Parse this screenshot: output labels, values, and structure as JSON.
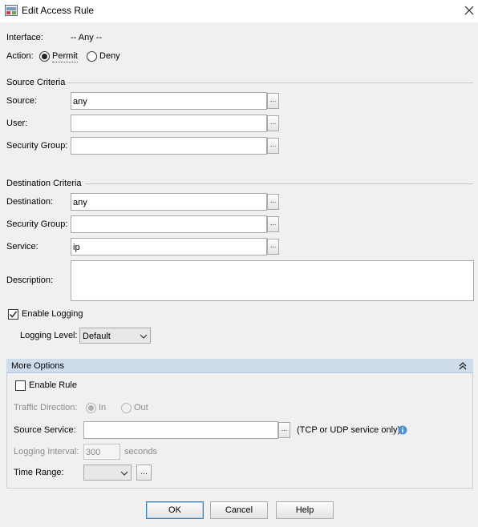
{
  "window": {
    "title": "Edit Access Rule",
    "icon": "asdm-app-icon",
    "close_icon": "close-icon"
  },
  "interface": {
    "label": "Interface:",
    "value": "-- Any --"
  },
  "action": {
    "label": "Action:",
    "options": [
      {
        "label": "Permit",
        "selected": true
      },
      {
        "label": "Deny",
        "selected": false
      }
    ]
  },
  "source_criteria": {
    "title": "Source Criteria",
    "source": {
      "label": "Source:",
      "value": "any"
    },
    "user": {
      "label": "User:",
      "value": ""
    },
    "security_group": {
      "label": "Security Group:",
      "value": ""
    },
    "browse_label": "..."
  },
  "destination_criteria": {
    "title": "Destination Criteria",
    "destination": {
      "label": "Destination:",
      "value": "any"
    },
    "security_group": {
      "label": "Security Group:",
      "value": ""
    },
    "service": {
      "label": "Service:",
      "value": "ip"
    },
    "browse_label": "..."
  },
  "description": {
    "label": "Description:",
    "value": ""
  },
  "logging": {
    "enable_label": "Enable Logging",
    "enabled": true,
    "level_label": "Logging Level:",
    "level_value": "Default"
  },
  "more_options": {
    "title": "More Options",
    "collapse_icon": "double-chevron-up-icon",
    "enable_rule": {
      "label": "Enable Rule",
      "checked": false
    },
    "traffic_direction": {
      "label": "Traffic Direction:",
      "options": [
        {
          "label": "In",
          "selected": true
        },
        {
          "label": "Out",
          "selected": false
        }
      ]
    },
    "source_service": {
      "label": "Source Service:",
      "value": "",
      "note": "(TCP or UDP service only)",
      "info_icon": "info-icon"
    },
    "logging_interval": {
      "label": "Logging Interval:",
      "value": "300",
      "unit": "seconds"
    },
    "time_range": {
      "label": "Time Range:",
      "value": "",
      "browse_label": "..."
    }
  },
  "buttons": {
    "ok": "OK",
    "cancel": "Cancel",
    "help": "Help"
  },
  "colors": {
    "panel_header": "#cfdcec",
    "default_button_border": "#3c7fb1",
    "info_icon": "#4a90d9"
  }
}
